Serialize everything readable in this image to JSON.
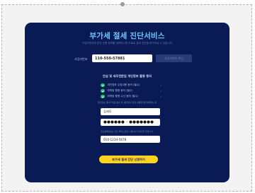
{
  "page": {
    "title": "부가세 절세 진단서비스",
    "subtitle": "사업자번호와 본인 인증 정보를 입력하시면 무료로 절세 진단을 받아보실 수 있습니다"
  },
  "business": {
    "label": "사업자번호",
    "value": "110-550-57881",
    "verify_button": "사업자번호 확인"
  },
  "consent": {
    "title": "안심 및 세무전문업 개인정보 활용 동의",
    "items": [
      {
        "label": "개인정보 수집이용 동의 (필수)",
        "checked": true
      },
      {
        "label": "마케팅 활용 동의 (필수)",
        "checked": true
      },
      {
        "label": "마케팅 활용 수신 동의 (필수)",
        "checked": true
      }
    ],
    "notice": "개인정보 제3자 제공 동의 및 세무대리 위임 내용을 확인하였습니다"
  },
  "form": {
    "name_value": "김세무",
    "rrn_value": "●●●●●● - ●●●●●●●",
    "rrn_note": "주민등록번호는 진단 목적으로만 사용되며 저장되지 않습니다",
    "phone_value": "010-1234-5678"
  },
  "submit": {
    "label": "부가세 절세 진단 신청하기"
  },
  "colors": {
    "card_bg": "#0a1a55",
    "title": "#6fc6ff",
    "check": "#22c36a",
    "submit": "#ffd21f"
  },
  "icons": {
    "check": "check-circle-icon",
    "chevron": "chevron-right-icon"
  }
}
